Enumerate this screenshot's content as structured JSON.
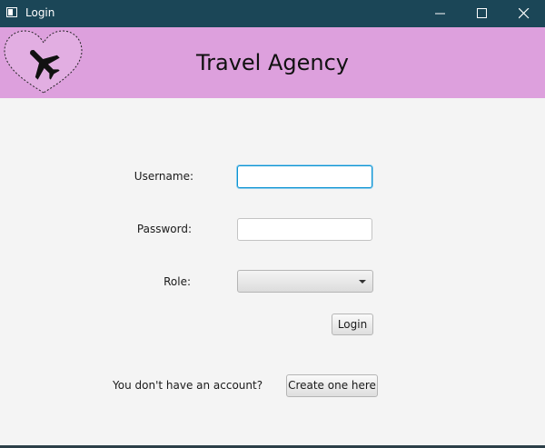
{
  "window": {
    "title": "Login",
    "icon": "app-window-icon",
    "controls": [
      "minimize-icon",
      "maximize-icon",
      "close-icon"
    ]
  },
  "header": {
    "title": "Travel Agency",
    "background": "#dda0dd",
    "logo": "heart-airplane-logo"
  },
  "form": {
    "username_label": "Username:",
    "username_value": "",
    "password_label": "Password:",
    "password_value": "",
    "role_label": "Role:",
    "role_value": "",
    "login_label": "Login"
  },
  "signup": {
    "prompt": "You don't have an account?",
    "button_label": "Create one here"
  },
  "colors": {
    "titlebar": "#1b4657",
    "content_bg": "#f4f4f4",
    "focus": "#0a93d2"
  }
}
